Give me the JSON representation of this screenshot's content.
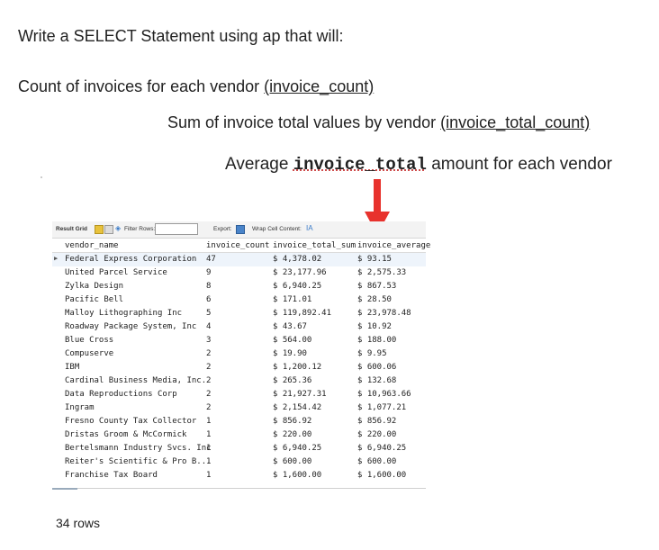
{
  "question": {
    "title": "Write a SELECT Statement using ap that will:",
    "line1_prefix": "Count of invoices for each vendor ",
    "line1_alias": "(invoice_count)",
    "line2_prefix": "Sum of invoice total values by vendor ",
    "line2_alias": "(invoice_total_count)",
    "line3_prefix": "Average ",
    "line3_code": "invoice_total",
    "line3_suffix": " amount for each vendor"
  },
  "accent_colors": {
    "arrow": "#e8322d"
  },
  "toolbar": {
    "result_grid": "Result Grid",
    "filter_rows": "Filter Rows:",
    "export": "Export:",
    "wrap_cell": "Wrap Cell Content:",
    "wrap_icon": "IA"
  },
  "table": {
    "columns": [
      "vendor_name",
      "invoice_count",
      "invoice_total_sum",
      "invoice_average"
    ],
    "rows": [
      [
        "Federal Express Corporation",
        "47",
        "$ 4,378.02",
        "$ 93.15"
      ],
      [
        "United Parcel Service",
        "9",
        "$ 23,177.96",
        "$ 2,575.33"
      ],
      [
        "Zylka Design",
        "8",
        "$ 6,940.25",
        "$ 867.53"
      ],
      [
        "Pacific Bell",
        "6",
        "$ 171.01",
        "$ 28.50"
      ],
      [
        "Malloy Lithographing Inc",
        "5",
        "$ 119,892.41",
        "$ 23,978.48"
      ],
      [
        "Roadway Package System, Inc",
        "4",
        "$ 43.67",
        "$ 10.92"
      ],
      [
        "Blue Cross",
        "3",
        "$ 564.00",
        "$ 188.00"
      ],
      [
        "Compuserve",
        "2",
        "$ 19.90",
        "$ 9.95"
      ],
      [
        "IBM",
        "2",
        "$ 1,200.12",
        "$ 600.06"
      ],
      [
        "Cardinal Business Media, Inc.",
        "2",
        "$ 265.36",
        "$ 132.68"
      ],
      [
        "Data Reproductions Corp",
        "2",
        "$ 21,927.31",
        "$ 10,963.66"
      ],
      [
        "Ingram",
        "2",
        "$ 2,154.42",
        "$ 1,077.21"
      ],
      [
        "Fresno County Tax Collector",
        "1",
        "$ 856.92",
        "$ 856.92"
      ],
      [
        "Dristas Groom & McCormick",
        "1",
        "$ 220.00",
        "$ 220.00"
      ],
      [
        "Bertelsmann Industry Svcs. Inc",
        "1",
        "$ 6,940.25",
        "$ 6,940.25"
      ],
      [
        "Reiter's Scientific & Pro B...",
        "1",
        "$ 600.00",
        "$ 600.00"
      ],
      [
        "Franchise Tax Board",
        "1",
        "$ 1,600.00",
        "$ 1,600.00"
      ]
    ]
  },
  "footer": {
    "row_count": "34 rows"
  }
}
